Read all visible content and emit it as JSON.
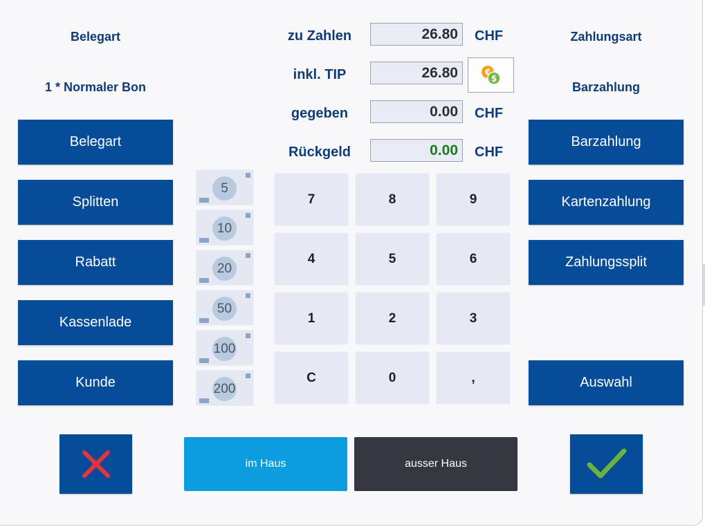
{
  "left": {
    "belegart_heading": "Belegart",
    "belegart_value": "1 * Normaler Bon",
    "buttons": [
      "Belegart",
      "Splitten",
      "Rabatt",
      "Kassenlade",
      "Kunde"
    ]
  },
  "right": {
    "zahlungsart_heading": "Zahlungsart",
    "zahlungsart_value": "Barzahlung",
    "buttons": [
      "Barzahlung",
      "Kartenzahlung",
      "Zahlungssplit",
      "Auswahl"
    ]
  },
  "amounts": {
    "zu_zahlen_label": "zu Zahlen",
    "zu_zahlen_value": "26.80",
    "tip_label": "inkl. TIP",
    "tip_value": "26.80",
    "gegeben_label": "gegeben",
    "gegeben_value": "0.00",
    "rueckgeld_label": "Rückgeld",
    "rueckgeld_value": "0.00",
    "currency": "CHF"
  },
  "banknotes": [
    "5",
    "10",
    "20",
    "50",
    "100",
    "200"
  ],
  "keypad": [
    "7",
    "8",
    "9",
    "4",
    "5",
    "6",
    "1",
    "2",
    "3",
    "C",
    "0",
    ","
  ],
  "bottom": {
    "cancel_icon": "close-x-icon",
    "confirm_icon": "checkmark-icon",
    "im_haus": "im Haus",
    "ausser_haus": "ausser Haus"
  },
  "colors": {
    "primary_blue": "#064c98",
    "im_haus_blue": "#0c9ce0",
    "ausser_haus_dark": "#353740",
    "cancel_red": "#e8333b",
    "confirm_green": "#6cb33e",
    "coin_orange": "#f2a31a",
    "coin_green": "#7ab648"
  }
}
